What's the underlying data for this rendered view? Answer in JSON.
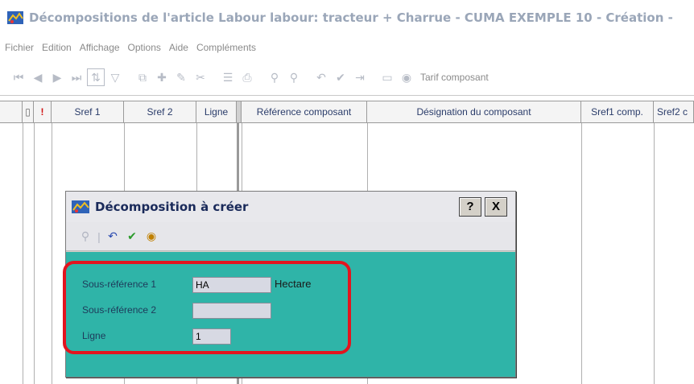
{
  "window": {
    "title": "Décompositions de l'article Labour labour: tracteur + Charrue - CUMA EXEMPLE 10 - Création -"
  },
  "menu": [
    "Fichier",
    "Edition",
    "Affichage",
    "Options",
    "Aide",
    "Compléments"
  ],
  "toolbar": {
    "icons": [
      "first-record-icon",
      "previous-record-icon",
      "next-record-icon",
      "last-record-icon",
      "sort-icon",
      "filter-icon",
      "copy-icon",
      "add-icon",
      "edit-icon",
      "delete-icon",
      "list-icon",
      "print-icon",
      "search-icon",
      "search-next-icon",
      "undo-icon",
      "validate-icon",
      "export-icon",
      "folder-icon",
      "help-icon"
    ],
    "label": "Tarif composant"
  },
  "grid": {
    "columns": [
      "",
      "!",
      "Sref 1",
      "Sref 2",
      "Ligne",
      "Référence composant",
      "Désignation du composant",
      "Sref1 comp.",
      "Sref2 c"
    ]
  },
  "dialog": {
    "title": "Décomposition à créer",
    "help_button": "?",
    "close_button": "X",
    "fields": {
      "sref1_label": "Sous-référence 1",
      "sref1_value": "HA",
      "sref1_suffix": "Hectare",
      "sref2_label": "Sous-référence 2",
      "sref2_value": "",
      "ligne_label": "Ligne",
      "ligne_value": "1"
    }
  },
  "colors": {
    "dialog_body": "#2fb4a8",
    "highlight": "#e3141e",
    "title_text": "#9aa6b8"
  }
}
